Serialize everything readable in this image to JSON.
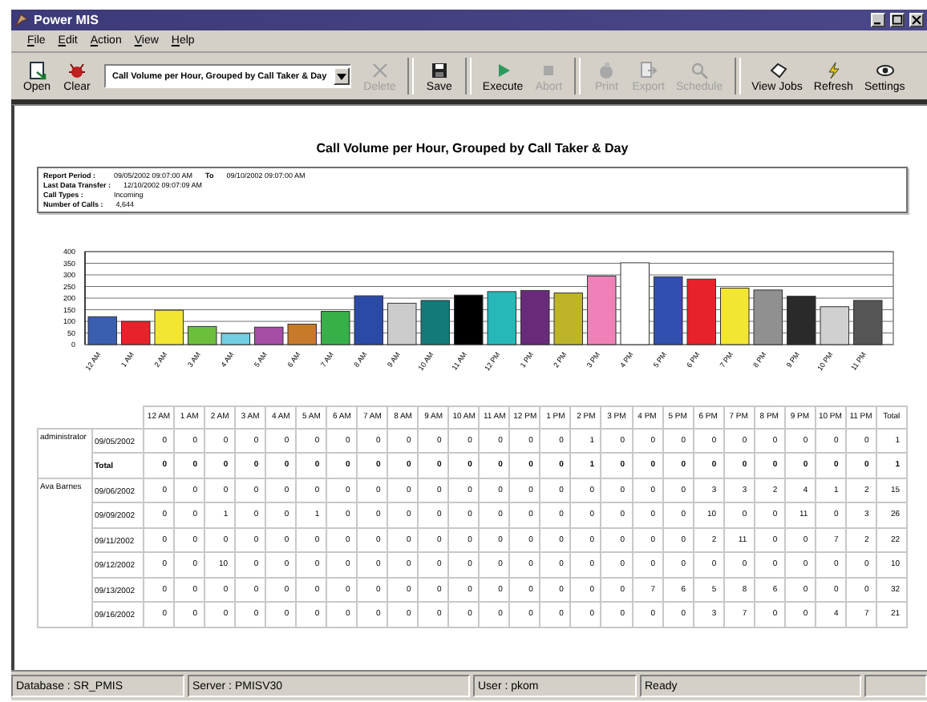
{
  "window": {
    "title": "Power MIS"
  },
  "menu": [
    "File",
    "Edit",
    "Action",
    "View",
    "Help"
  ],
  "toolbar": [
    {
      "kind": "button",
      "label": "Open",
      "disabled": false
    },
    {
      "kind": "button",
      "label": "Clear",
      "disabled": false
    },
    {
      "kind": "dropdown",
      "value": "Call Volume per Hour, Grouped by Call Taker & Day"
    },
    {
      "kind": "button",
      "label": "Delete",
      "disabled": true
    },
    {
      "kind": "separator"
    },
    {
      "kind": "button",
      "label": "Save",
      "disabled": false
    },
    {
      "kind": "separator"
    },
    {
      "kind": "button",
      "label": "Execute",
      "disabled": false
    },
    {
      "kind": "button",
      "label": "Abort",
      "disabled": true
    },
    {
      "kind": "separator"
    },
    {
      "kind": "button",
      "label": "Print",
      "disabled": true
    },
    {
      "kind": "button",
      "label": "Export",
      "disabled": true
    },
    {
      "kind": "button",
      "label": "Schedule",
      "disabled": true
    },
    {
      "kind": "separator"
    },
    {
      "kind": "button",
      "label": "View Jobs",
      "disabled": false
    },
    {
      "kind": "button",
      "label": "Refresh",
      "disabled": false
    },
    {
      "kind": "button",
      "label": "Settings",
      "disabled": false
    }
  ],
  "report": {
    "title": "Call Volume per Hour, Grouped by Call Taker & Day",
    "info": [
      {
        "label": "Report Period :",
        "value": "09/05/2002 09:07:00 AM",
        "to_label": "To",
        "to_value": "09/10/2002 09:07:00 AM"
      },
      {
        "label": "Last Data Transfer :",
        "value": "12/10/2002 09:07:09 AM"
      },
      {
        "label": "Call Types :",
        "value": "Incoming"
      },
      {
        "label": "Number of Calls :",
        "value": "4,644"
      }
    ],
    "chart_data": {
      "type": "bar",
      "categories": [
        "12 AM",
        "1 AM",
        "2 AM",
        "3 AM",
        "4 AM",
        "5 AM",
        "6 AM",
        "7 AM",
        "8 AM",
        "9 AM",
        "10 AM",
        "11 AM",
        "12 PM",
        "1 PM",
        "2 PM",
        "3 PM",
        "4 PM",
        "5 PM",
        "6 PM",
        "7 PM",
        "8 PM",
        "9 PM",
        "10 PM",
        "11 PM"
      ],
      "series": [
        {
          "colors": [
            "#3a5fb0",
            "#e8222a",
            "#f2e632",
            "#6cbf3b",
            "#72d0e6",
            "#a64ea6",
            "#c87a2a",
            "#38b04a",
            "#2b4aa8",
            "#cccccc",
            "#137a78",
            "#000000",
            "#26b8b8",
            "#6a2a7a",
            "#bdb42a",
            "#f080b8",
            "#ffffff",
            "#3050b0",
            "#e8222a",
            "#f2e632",
            "#909090",
            "#2a2a2a",
            "#d0d0d0",
            "#555555"
          ],
          "values": [
            120,
            100,
            148,
            78,
            48,
            75,
            88,
            143,
            210,
            178,
            190,
            213,
            228,
            233,
            222,
            295,
            352,
            292,
            282,
            243,
            235,
            208,
            163,
            190
          ]
        }
      ],
      "grid": true,
      "ylim": [
        0,
        400
      ],
      "yticks": [
        0,
        50,
        100,
        150,
        200,
        250,
        300,
        350,
        400
      ]
    },
    "table": {
      "columns": [
        "12 AM",
        "1 AM",
        "2 AM",
        "3 AM",
        "4 AM",
        "5 AM",
        "6 AM",
        "7 AM",
        "8 AM",
        "9 AM",
        "10 AM",
        "11 AM",
        "12 PM",
        "1 PM",
        "2 PM",
        "3 PM",
        "4 PM",
        "5 PM",
        "6 PM",
        "7 PM",
        "8 PM",
        "9 PM",
        "10 PM",
        "11 PM",
        "Total"
      ],
      "groups": [
        {
          "name": "administrator",
          "rows": [
            {
              "label": "09/05/2002",
              "kind": "date",
              "values": [
                "0",
                "0",
                "0",
                "0",
                "0",
                "0",
                "0",
                "0",
                "0",
                "0",
                "0",
                "0",
                "0",
                "0",
                "1",
                "0",
                "0",
                "0",
                "0",
                "0",
                "0",
                "0",
                "0",
                "0"
              ],
              "total": "1"
            },
            {
              "label": "Total",
              "kind": "total",
              "values": [
                "0",
                "0",
                "0",
                "0",
                "0",
                "0",
                "0",
                "0",
                "0",
                "0",
                "0",
                "0",
                "0",
                "0",
                "1",
                "0",
                "0",
                "0",
                "0",
                "0",
                "0",
                "0",
                "0",
                "0"
              ],
              "total": "1"
            }
          ]
        },
        {
          "name": "Ava Barnes",
          "rows": [
            {
              "label": "09/06/2002",
              "kind": "date",
              "values": [
                "0",
                "0",
                "0",
                "0",
                "0",
                "0",
                "0",
                "0",
                "0",
                "0",
                "0",
                "0",
                "0",
                "0",
                "0",
                "0",
                "0",
                "0",
                "3",
                "3",
                "2",
                "4",
                "1",
                "2"
              ],
              "total": "15"
            },
            {
              "label": "09/09/2002",
              "kind": "date",
              "values": [
                "0",
                "0",
                "1",
                "0",
                "0",
                "1",
                "0",
                "0",
                "0",
                "0",
                "0",
                "0",
                "0",
                "0",
                "0",
                "0",
                "0",
                "0",
                "10",
                "0",
                "0",
                "11",
                "0",
                "3"
              ],
              "total": "26"
            },
            {
              "label": "09/11/2002",
              "kind": "date",
              "values": [
                "0",
                "0",
                "0",
                "0",
                "0",
                "0",
                "0",
                "0",
                "0",
                "0",
                "0",
                "0",
                "0",
                "0",
                "0",
                "0",
                "0",
                "0",
                "2",
                "11",
                "0",
                "0",
                "7",
                "2"
              ],
              "total": "22"
            },
            {
              "label": "09/12/2002",
              "kind": "date",
              "values": [
                "0",
                "0",
                "10",
                "0",
                "0",
                "0",
                "0",
                "0",
                "0",
                "0",
                "0",
                "0",
                "0",
                "0",
                "0",
                "0",
                "0",
                "0",
                "0",
                "0",
                "0",
                "0",
                "0",
                "0"
              ],
              "total": "10"
            },
            {
              "label": "09/13/2002",
              "kind": "date",
              "values": [
                "0",
                "0",
                "0",
                "0",
                "0",
                "0",
                "0",
                "0",
                "0",
                "0",
                "0",
                "0",
                "0",
                "0",
                "0",
                "0",
                "7",
                "6",
                "5",
                "8",
                "6",
                "0",
                "0",
                "0"
              ],
              "total": "32"
            },
            {
              "label": "09/16/2002",
              "kind": "date",
              "values": [
                "0",
                "0",
                "0",
                "0",
                "0",
                "0",
                "0",
                "0",
                "0",
                "0",
                "0",
                "0",
                "0",
                "0",
                "0",
                "0",
                "0",
                "0",
                "3",
                "7",
                "0",
                "0",
                "4",
                "7"
              ],
              "total": "21"
            }
          ]
        }
      ]
    }
  },
  "status_bar": [
    "Database : SR_PMIS",
    "Server : PMISV30",
    "User : pkom",
    "Ready"
  ]
}
